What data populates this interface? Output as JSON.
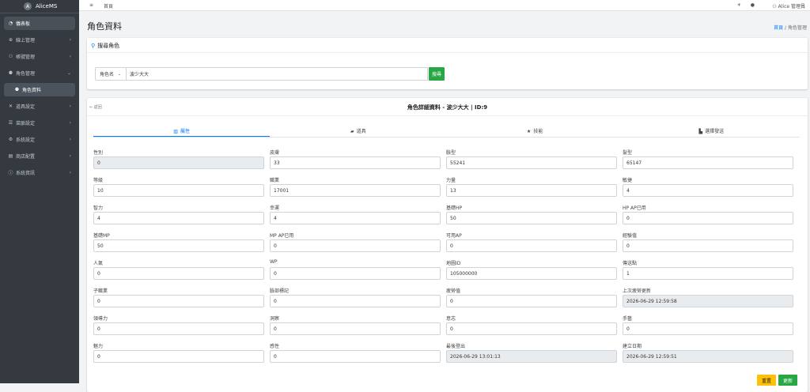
{
  "brand": {
    "name": "AliceMS",
    "logo_letter": "A"
  },
  "sidebar": {
    "items": [
      {
        "label": "儀表板",
        "icon": "dashboard-icon"
      },
      {
        "label": "線上管理",
        "icon": "globe-icon"
      },
      {
        "label": "帳號管理",
        "icon": "users-icon"
      },
      {
        "label": "角色管理",
        "icon": "user-group-icon"
      },
      {
        "label": "角色資料",
        "icon": "user-icon"
      },
      {
        "label": "道具設定",
        "icon": "tools-icon"
      },
      {
        "label": "菜脈設定",
        "icon": "list-icon"
      },
      {
        "label": "系統設定",
        "icon": "gear-icon"
      },
      {
        "label": "商店配置",
        "icon": "store-icon"
      },
      {
        "label": "系統資訊",
        "icon": "info-icon"
      }
    ]
  },
  "topbar": {
    "home": "首頁",
    "user": "Alice 管理員"
  },
  "page": {
    "title": "角色資料",
    "breadcrumb_home": "首頁",
    "breadcrumb_current": "角色管理"
  },
  "search": {
    "header": "搜尋角色",
    "select_value": "角色名",
    "input_value": "波少大大",
    "button": "搜尋"
  },
  "detail": {
    "back": "返回",
    "title": "角色詳細資料 - 波少大大 | ID:9",
    "tabs": [
      {
        "label": "屬性",
        "icon": "chart-icon"
      },
      {
        "label": "道具",
        "icon": "box-icon"
      },
      {
        "label": "技能",
        "icon": "star-icon"
      },
      {
        "label": "選擇發送",
        "icon": "send-icon"
      }
    ],
    "fields": [
      {
        "label": "性別",
        "value": "0",
        "readonly": true
      },
      {
        "label": "皮膚",
        "value": "33",
        "readonly": false
      },
      {
        "label": "臉型",
        "value": "55241",
        "readonly": false
      },
      {
        "label": "髮型",
        "value": "65147",
        "readonly": false
      },
      {
        "label": "等級",
        "value": "10",
        "readonly": false
      },
      {
        "label": "職業",
        "value": "17001",
        "readonly": false
      },
      {
        "label": "力量",
        "value": "13",
        "readonly": false
      },
      {
        "label": "敏捷",
        "value": "4",
        "readonly": false
      },
      {
        "label": "智力",
        "value": "4",
        "readonly": false
      },
      {
        "label": "幸運",
        "value": "4",
        "readonly": false
      },
      {
        "label": "基礎HP",
        "value": "50",
        "readonly": false
      },
      {
        "label": "HP AP已用",
        "value": "0",
        "readonly": false
      },
      {
        "label": "基礎MP",
        "value": "50",
        "readonly": false
      },
      {
        "label": "MP AP已用",
        "value": "0",
        "readonly": false
      },
      {
        "label": "可用AP",
        "value": "0",
        "readonly": false
      },
      {
        "label": "經驗值",
        "value": "0",
        "readonly": false
      },
      {
        "label": "人氣",
        "value": "0",
        "readonly": false
      },
      {
        "label": "WP",
        "value": "0",
        "readonly": false
      },
      {
        "label": "地圖ID",
        "value": "105000000",
        "readonly": false
      },
      {
        "label": "傳送點",
        "value": "1",
        "readonly": false
      },
      {
        "label": "子職業",
        "value": "0",
        "readonly": false
      },
      {
        "label": "臉部標記",
        "value": "0",
        "readonly": false
      },
      {
        "label": "疲勞值",
        "value": "0",
        "readonly": false
      },
      {
        "label": "上次疲勞更新",
        "value": "2026-06-29 12:59:58",
        "readonly": true
      },
      {
        "label": "領導力",
        "value": "0",
        "readonly": false
      },
      {
        "label": "洞察",
        "value": "0",
        "readonly": false
      },
      {
        "label": "意志",
        "value": "0",
        "readonly": false
      },
      {
        "label": "手藝",
        "value": "0",
        "readonly": false
      },
      {
        "label": "魅力",
        "value": "0",
        "readonly": false
      },
      {
        "label": "感性",
        "value": "0",
        "readonly": false
      },
      {
        "label": "最後登出",
        "value": "2026-06-29 13:01:13",
        "readonly": true
      },
      {
        "label": "建立日期",
        "value": "2026-06-29 12:59:51",
        "readonly": true
      }
    ],
    "reset_button": "重置",
    "update_button": "更新"
  }
}
